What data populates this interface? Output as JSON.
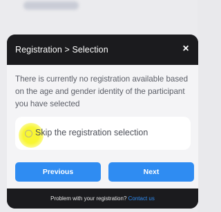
{
  "modal": {
    "title": "Registration > Selection",
    "close_icon": "close-icon",
    "close_glyph": "×",
    "message": "There is currently no registration available based on the age and gender identity of the participant you have selected",
    "option": {
      "label_bold": "Skip",
      "label_rest": " the registration selection",
      "selected": false
    },
    "buttons": {
      "previous": "Previous",
      "next": "Next"
    },
    "footer": {
      "text": "Problem with your registration? ",
      "link": "Contact us"
    }
  },
  "colors": {
    "header_bg": "#1b1b1e",
    "body_bg": "#f4f4f6",
    "button_bg": "#2f8cf2",
    "link": "#2f8cf2",
    "highlight": "#f8f528"
  }
}
